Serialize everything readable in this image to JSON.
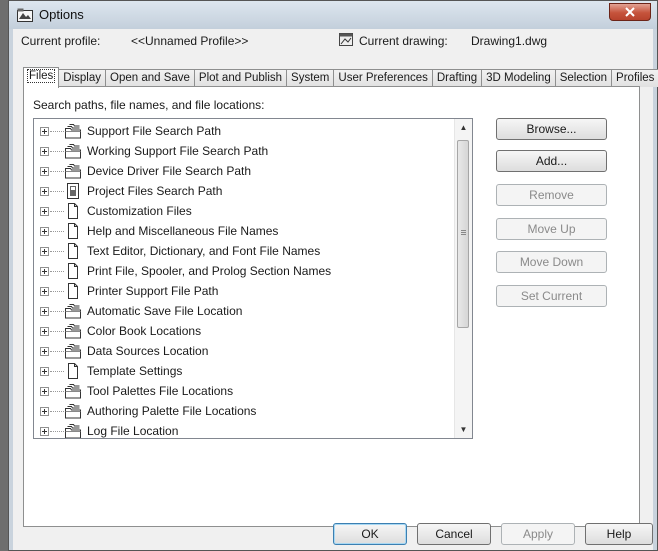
{
  "window": {
    "title": "Options"
  },
  "profile": {
    "current_profile_label": "Current profile:",
    "current_profile_value": "<<Unnamed Profile>>",
    "current_drawing_label": "Current drawing:",
    "current_drawing_value": "Drawing1.dwg"
  },
  "tabs": [
    {
      "label": "Files",
      "active": true
    },
    {
      "label": "Display"
    },
    {
      "label": "Open and Save"
    },
    {
      "label": "Plot and Publish"
    },
    {
      "label": "System"
    },
    {
      "label": "User Preferences"
    },
    {
      "label": "Drafting"
    },
    {
      "label": "3D Modeling"
    },
    {
      "label": "Selection"
    },
    {
      "label": "Profiles"
    }
  ],
  "files": {
    "section_label": "Search paths, file names, and file locations:",
    "tree_items": [
      {
        "label": "Support File Search Path",
        "icon": "folder-stack-icon"
      },
      {
        "label": "Working Support File Search Path",
        "icon": "folder-stack-icon"
      },
      {
        "label": "Device Driver File Search Path",
        "icon": "folder-stack-icon"
      },
      {
        "label": "Project Files Search Path",
        "icon": "project-file-icon"
      },
      {
        "label": "Customization Files",
        "icon": "document-icon"
      },
      {
        "label": "Help and Miscellaneous File Names",
        "icon": "document-icon"
      },
      {
        "label": "Text Editor, Dictionary, and Font File Names",
        "icon": "document-icon"
      },
      {
        "label": "Print File, Spooler, and Prolog Section Names",
        "icon": "document-icon"
      },
      {
        "label": "Printer Support File Path",
        "icon": "document-icon"
      },
      {
        "label": "Automatic Save File Location",
        "icon": "folder-stack-icon"
      },
      {
        "label": "Color Book Locations",
        "icon": "folder-stack-icon"
      },
      {
        "label": "Data Sources Location",
        "icon": "folder-stack-icon"
      },
      {
        "label": "Template Settings",
        "icon": "document-icon"
      },
      {
        "label": "Tool Palettes File Locations",
        "icon": "folder-stack-icon"
      },
      {
        "label": "Authoring Palette File Locations",
        "icon": "folder-stack-icon"
      },
      {
        "label": "Log File Location",
        "icon": "folder-stack-icon"
      }
    ],
    "buttons": {
      "browse": "Browse...",
      "add": "Add...",
      "remove": "Remove",
      "move_up": "Move Up",
      "move_down": "Move Down",
      "set_current": "Set Current"
    }
  },
  "footer": {
    "ok": "OK",
    "cancel": "Cancel",
    "apply": "Apply",
    "help": "Help"
  }
}
